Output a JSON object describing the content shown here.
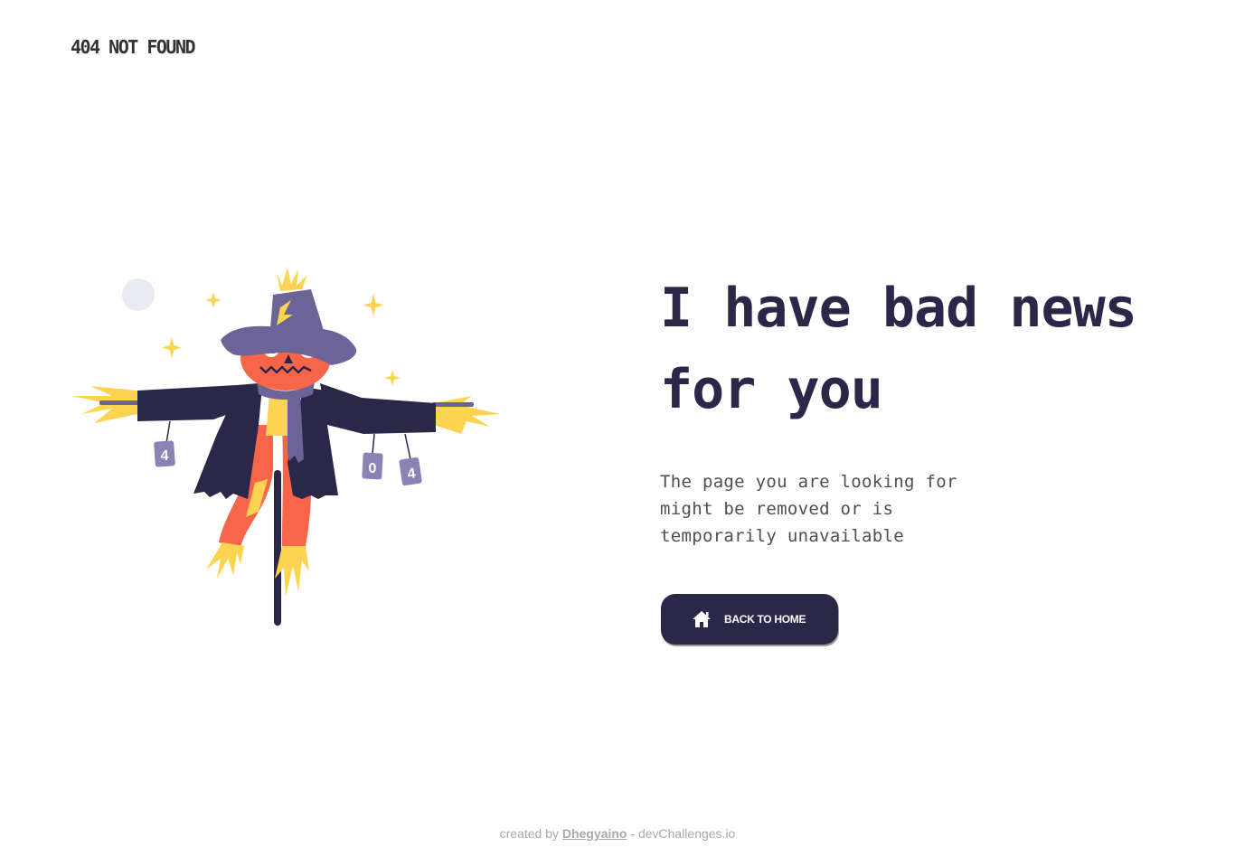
{
  "header": {
    "brand": "404 NOT FOUND"
  },
  "illustration": {
    "name": "scarecrow",
    "can_labels": [
      "4",
      "0",
      "4"
    ]
  },
  "main": {
    "headline": "I have bad news for you",
    "message": "The page you are looking for might be removed or is temporarily unavailable",
    "button": {
      "label": "BACK TO HOME",
      "icon": "home-icon"
    }
  },
  "footer": {
    "prefix": "created by",
    "author": "Dhegyaino",
    "separator": " - ",
    "site": "devChallenges.io"
  },
  "colors": {
    "navy": "#2b2748",
    "purple": "#6c6397",
    "coral": "#f96549",
    "yellow": "#fcd451",
    "moon": "#e8eaf4",
    "text": "#4f4f4f"
  }
}
